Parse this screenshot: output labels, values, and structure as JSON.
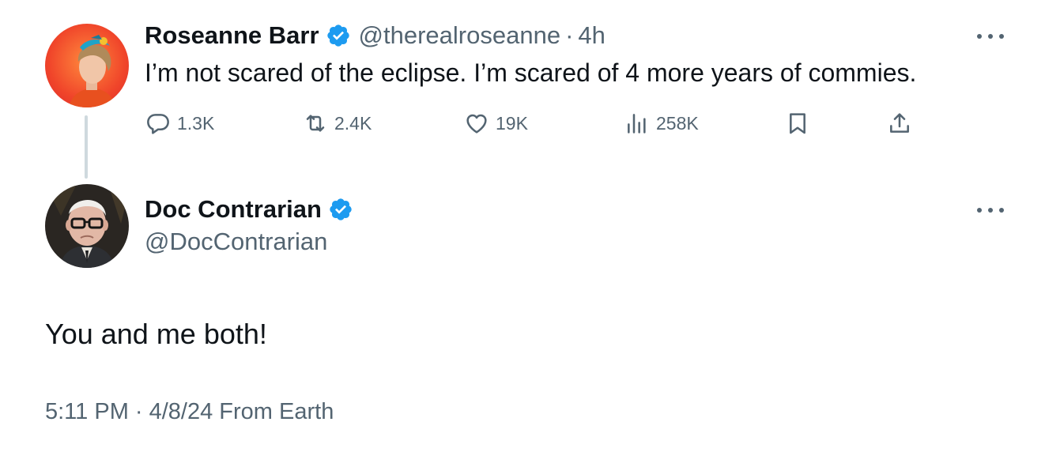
{
  "parent_tweet": {
    "author_name": "Roseanne Barr",
    "handle": "@therealroseanne",
    "separator": "·",
    "time": "4h",
    "text": "I’m not scared of the eclipse. I’m scared of 4 more years of commies.",
    "actions": {
      "replies": "1.3K",
      "retweets": "2.4K",
      "likes": "19K",
      "views": "258K"
    },
    "icons": [
      "reply-icon",
      "retweet-icon",
      "like-icon",
      "views-icon",
      "bookmark-icon",
      "share-icon",
      "more-icon",
      "verified-badge-icon"
    ]
  },
  "reply_tweet": {
    "author_name": "Doc Contrarian",
    "handle": "@DocContrarian",
    "text": "You and me both!",
    "meta": "5:11 PM · 4/8/24 From Earth"
  },
  "colors": {
    "text_primary": "#0f1419",
    "text_secondary": "#536471",
    "verified_blue": "#1d9bf0",
    "thread_line": "#cfd9de"
  }
}
